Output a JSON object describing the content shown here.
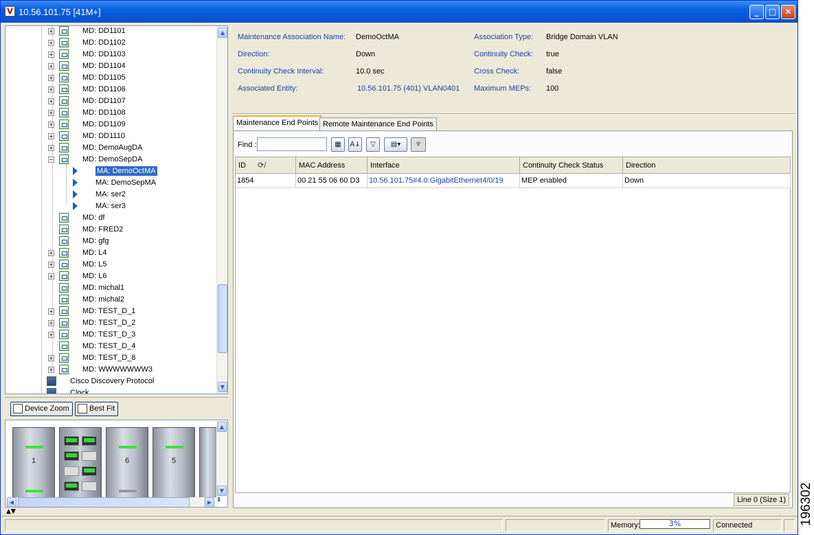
{
  "window": {
    "title": "10.56.101.75 [41M+]",
    "app_icon": "V"
  },
  "tree": {
    "items": [
      {
        "label": "MD: DD1101",
        "type": "md",
        "expandable": true
      },
      {
        "label": "MD: DD1102",
        "type": "md",
        "expandable": true
      },
      {
        "label": "MD: DD1103",
        "type": "md",
        "expandable": true
      },
      {
        "label": "MD: DD1104",
        "type": "md",
        "expandable": true
      },
      {
        "label": "MD: DD1105",
        "type": "md",
        "expandable": true
      },
      {
        "label": "MD: DD1106",
        "type": "md",
        "expandable": true
      },
      {
        "label": "MD: DD1107",
        "type": "md",
        "expandable": true
      },
      {
        "label": "MD: DD1108",
        "type": "md",
        "expandable": true
      },
      {
        "label": "MD: DD1109",
        "type": "md",
        "expandable": true
      },
      {
        "label": "MD: DD1110",
        "type": "md",
        "expandable": true
      },
      {
        "label": "MD: DemoAugDA",
        "type": "md",
        "expandable": true
      },
      {
        "label": "MD: DemoSepDA",
        "type": "md",
        "expandable": true,
        "expanded": true
      },
      {
        "label": "MA: DemoOctMA",
        "type": "ma",
        "selected": true
      },
      {
        "label": "MA: DemoSepMA",
        "type": "ma"
      },
      {
        "label": "MA: ser2",
        "type": "ma"
      },
      {
        "label": "MA: ser3",
        "type": "ma"
      },
      {
        "label": "MD: df",
        "type": "md",
        "expandable": false
      },
      {
        "label": "MD: FRED2",
        "type": "md",
        "expandable": false
      },
      {
        "label": "MD: gfg",
        "type": "md",
        "expandable": false
      },
      {
        "label": "MD: L4",
        "type": "md",
        "expandable": true
      },
      {
        "label": "MD: L5",
        "type": "md",
        "expandable": true
      },
      {
        "label": "MD: L6",
        "type": "md",
        "expandable": true
      },
      {
        "label": "MD: michal1",
        "type": "md",
        "expandable": false
      },
      {
        "label": "MD: michal2",
        "type": "md",
        "expandable": false
      },
      {
        "label": "MD: TEST_D_1",
        "type": "md",
        "expandable": true
      },
      {
        "label": "MD: TEST_D_2",
        "type": "md",
        "expandable": true
      },
      {
        "label": "MD: TEST_D_3",
        "type": "md",
        "expandable": true
      },
      {
        "label": "MD: TEST_D_4",
        "type": "md",
        "expandable": false
      },
      {
        "label": "MD: TEST_D_8",
        "type": "md",
        "expandable": true
      },
      {
        "label": "MD: WWWWWWW3",
        "type": "md",
        "expandable": true
      },
      {
        "label": "Cisco Discovery Protocol",
        "type": "top"
      },
      {
        "label": "Clock",
        "type": "top"
      }
    ]
  },
  "zoom": {
    "device_zoom_label": "Device Zoom",
    "best_fit_label": "Best Fit"
  },
  "device": {
    "slot_numbers": [
      "1",
      "6",
      "5"
    ]
  },
  "properties": {
    "ma_name_label": "Maintenance Association Name:",
    "ma_name_value": "DemoOctMA",
    "direction_label": "Direction:",
    "direction_value": "Down",
    "cc_interval_label": "Continuity Check Interval:",
    "cc_interval_value": "10.0 sec",
    "assoc_entity_label": "Associated Entity:",
    "assoc_entity_value": "10.56.101.75 (401) VLAN0401",
    "assoc_type_label": "Association Type:",
    "assoc_type_value": "Bridge Domain VLAN",
    "cc_label": "Continuity Check:",
    "cc_value": "true",
    "cross_check_label": "Cross Check:",
    "cross_check_value": "false",
    "max_meps_label": "Maximum MEPs:",
    "max_meps_value": "100"
  },
  "tabs": [
    {
      "label": "Maintenance End Points",
      "active": true
    },
    {
      "label": "Remote Maintenance End Points",
      "active": false
    }
  ],
  "table": {
    "find_label": "Find :",
    "find_value": "",
    "columns": [
      "ID",
      "MAC Address",
      "Interface",
      "Continuity Check Status",
      "Direction"
    ],
    "rows": [
      [
        "1854",
        "00 21 55 06 60 D3",
        "10.56.101.75#4.0:GigabitEthernet4/0/19",
        "MEP enabled",
        "Down"
      ]
    ],
    "status": "Line 0 (Size 1)"
  },
  "statusbar": {
    "memory_label": "Memory:",
    "memory_value": "3%",
    "connection": "Connected"
  },
  "image_number": "196302"
}
